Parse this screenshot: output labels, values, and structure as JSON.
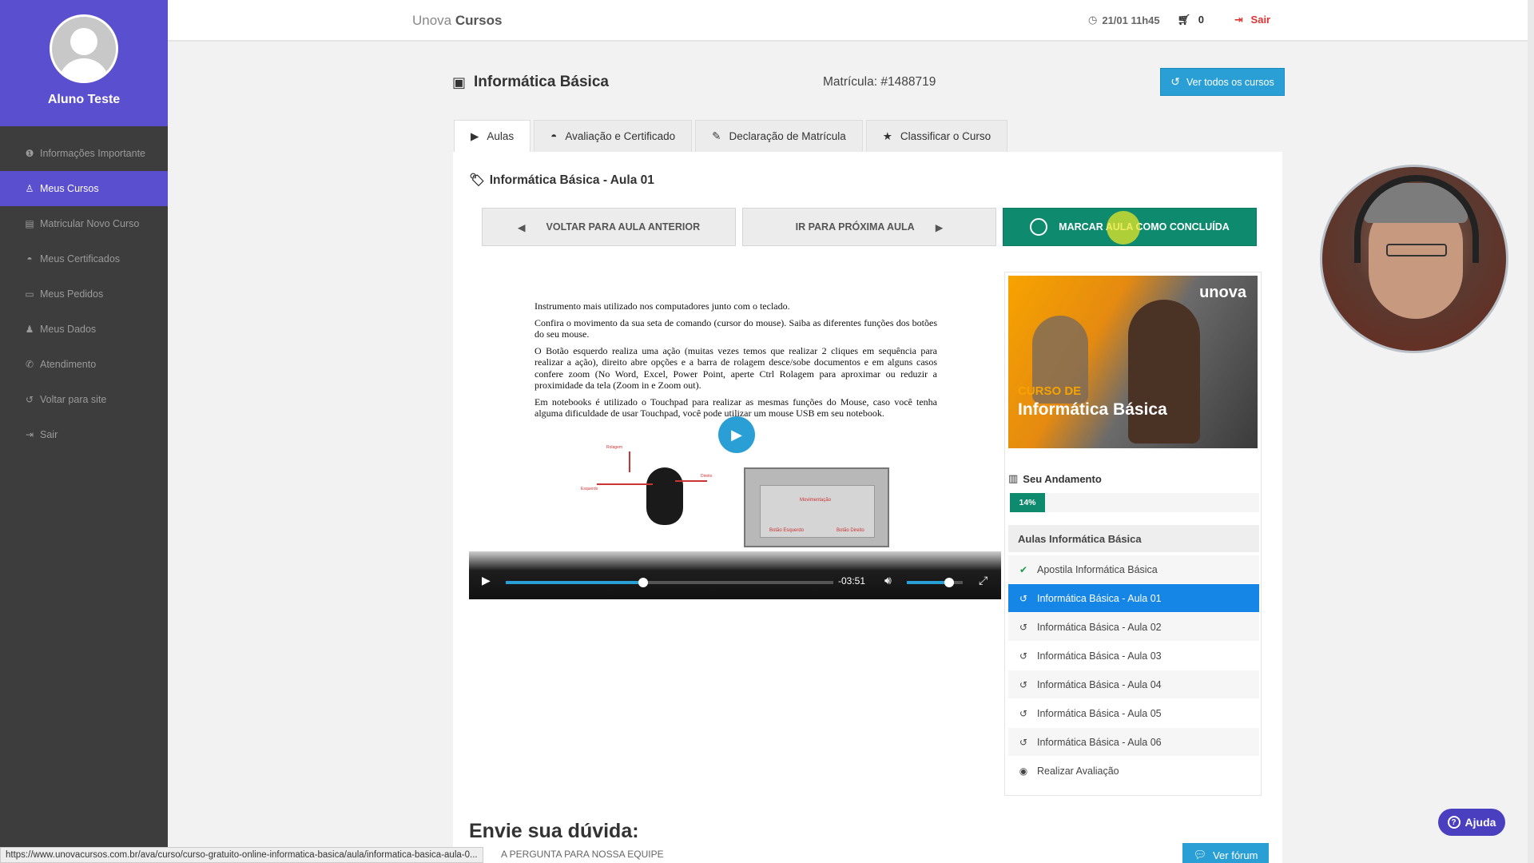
{
  "sidebar": {
    "user_name": "Aluno Teste",
    "items": [
      {
        "label": "Informações Importante",
        "icon": "info-icon",
        "glyph": "❶"
      },
      {
        "label": "Meus Cursos",
        "icon": "graduate-icon",
        "glyph": "♙",
        "active": true
      },
      {
        "label": "Matricular Novo Curso",
        "icon": "book-icon",
        "glyph": "▤"
      },
      {
        "label": "Meus Certificados",
        "icon": "mortarboard-icon",
        "glyph": "◓"
      },
      {
        "label": "Meus Pedidos",
        "icon": "card-icon",
        "glyph": "▭"
      },
      {
        "label": "Meus Dados",
        "icon": "user-icon",
        "glyph": "♟"
      },
      {
        "label": "Atendimento",
        "icon": "phone-icon",
        "glyph": "✆"
      },
      {
        "label": "Voltar para site",
        "icon": "undo-icon",
        "glyph": "↺"
      },
      {
        "label": "Sair",
        "icon": "signout-icon",
        "glyph": "⇥"
      }
    ]
  },
  "topbar": {
    "brand_light": "Unova",
    "brand_bold": "Cursos",
    "datetime": "21/01 11h45",
    "cart_count": "0",
    "logout": "Sair"
  },
  "header": {
    "course_title": "Informática Básica",
    "matricula": "Matrícula: #1488719",
    "all_courses": "Ver todos os cursos"
  },
  "tabs": [
    {
      "label": "Aulas",
      "icon": "play-icon",
      "glyph": "▶",
      "active": true
    },
    {
      "label": "Avaliação e Certificado",
      "icon": "mortarboard-icon",
      "glyph": "◓"
    },
    {
      "label": "Declaração de Matrícula",
      "icon": "document-icon",
      "glyph": "✎"
    },
    {
      "label": "Classificar o Curso",
      "icon": "star-icon",
      "glyph": "★"
    }
  ],
  "lesson": {
    "title": "Informática Básica - Aula 01",
    "prev": "VOLTAR PARA AULA ANTERIOR",
    "next": "IR PARA PRÓXIMA AULA",
    "mark_done": "MARCAR AULA COMO CONCLUÍDA"
  },
  "video": {
    "paragraphs": [
      "Instrumento mais utilizado nos computadores junto com o teclado.",
      "Confira o movimento da sua seta de comando (cursor do mouse). Saiba as diferentes funções dos botões do seu mouse.",
      "O Botão esquerdo realiza uma ação (muitas vezes temos que realizar 2 cliques em sequência para realizar a ação), direito abre opções e a barra de rolagem desce/sobe documentos e em alguns casos confere zoom (No Word, Excel, Power Point, aperte Ctrl Rolagem para aproximar ou reduzir a proximidade da tela (Zoom in e Zoom out).",
      "Em notebooks é utilizado o Touchpad para realizar as mesmas funções do Mouse, caso você tenha alguma dificuldade de usar Touchpad, você pode utilizar um mouse USB em seu notebook."
    ],
    "mouse_labels": {
      "rolagem": "Rolagem",
      "esquerdo": "Esquerdo",
      "direito": "Direito"
    },
    "touchpad_labels": {
      "mov": "Movimentação",
      "left": "Botão Esquerdo",
      "right": "Botão Direito"
    },
    "time_remaining": "-03:51",
    "progress": 0.42,
    "volume": 0.75
  },
  "course_panel": {
    "banner_logo": "unova",
    "banner_pre": "CURSO DE",
    "banner_main": "Informática Básica",
    "progress_label": "Seu Andamento",
    "progress_value": "14%",
    "lessons_heading": "Aulas Informática Básica",
    "lessons": [
      {
        "label": "Apostila Informática Básica",
        "icon": "check-circle-icon",
        "glyph": "✔"
      },
      {
        "label": "Informática Básica - Aula 01",
        "icon": "history-icon",
        "glyph": "↺",
        "active": true
      },
      {
        "label": "Informática Básica - Aula 02",
        "icon": "history-icon",
        "glyph": "↺"
      },
      {
        "label": "Informática Básica - Aula 03",
        "icon": "history-icon",
        "glyph": "↺"
      },
      {
        "label": "Informática Básica - Aula 04",
        "icon": "history-icon",
        "glyph": "↺"
      },
      {
        "label": "Informática Básica - Aula 05",
        "icon": "history-icon",
        "glyph": "↺"
      },
      {
        "label": "Informática Básica - Aula 06",
        "icon": "history-icon",
        "glyph": "↺"
      },
      {
        "label": "Realizar Avaliação",
        "icon": "dot-circle-icon",
        "glyph": "◉"
      }
    ]
  },
  "question": {
    "title": "Envie sua dúvida:",
    "subtitle": "A PERGUNTA PARA NOSSA EQUIPE",
    "forum_button": "Ver fórum"
  },
  "help": "Ajuda",
  "status_url": "https://www.unovacursos.com.br/ava/curso/curso-gratuito-online-informatica-basica/aula/informatica-basica-aula-0..."
}
